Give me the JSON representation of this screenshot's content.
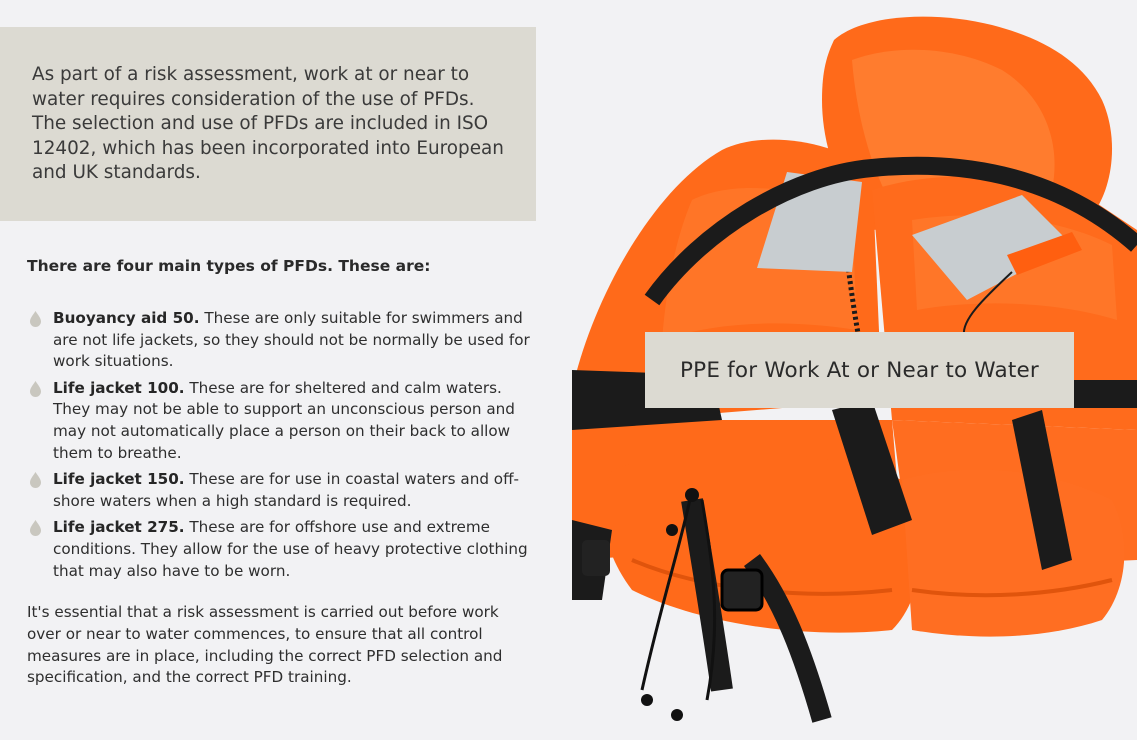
{
  "intro": {
    "text": "As part of a risk assessment, work at or near to water requires consideration of the use of PFDs. The selection and use of PFDs are included in ISO 12402, which has been incorporated into European and UK standards."
  },
  "lead": "There are four main types of PFDs. These are:",
  "types": [
    {
      "name": "Buoyancy aid 50.",
      "description": " These are only suitable for swimmers and are not life jackets, so they should not be normally be used for work situations."
    },
    {
      "name": "Life jacket 100.",
      "description": " These are for sheltered and calm waters. They may not be able to support an unconscious person and may not automatically place a person on their back to allow them to breathe."
    },
    {
      "name": "Life jacket 150.",
      "description": " These are for use in coastal waters and off-shore waters when a high standard is required."
    },
    {
      "name": "Life jacket 275.",
      "description": " These are for offshore use and extreme conditions. They allow for the use of heavy protective clothing that may also have to be worn."
    }
  ],
  "closing": "It's essential that a risk assessment is carried out before work over or near to water commences, to ensure that all control measures are in place, including the correct PFD selection and specification, and the correct PFD training.",
  "caption": "PPE for Work At or Near to Water",
  "colors": {
    "panel": "#dcdad2",
    "background": "#f2f2f4",
    "jacket_orange": "#ff6a1a",
    "strap_black": "#1b1b1b"
  },
  "icons": {
    "bullet": "droplet-icon"
  }
}
